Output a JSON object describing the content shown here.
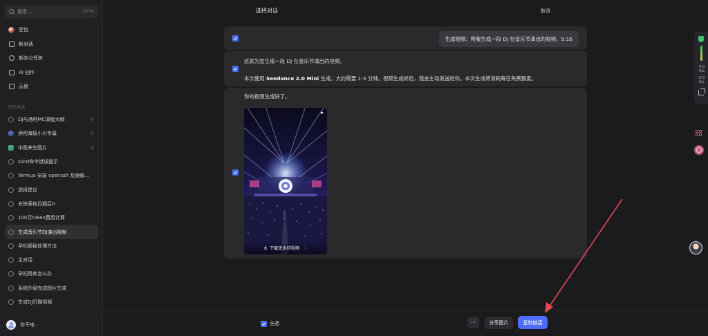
{
  "sidebar": {
    "search_placeholder": "搜索...",
    "search_shortcut": "Ctrl K",
    "nav": [
      {
        "label": "豆包",
        "icon": "doubao-logo-icon"
      },
      {
        "label": "新对话",
        "icon": "new-chat-icon"
      },
      {
        "label": "新办公任务",
        "icon": "task-icon"
      },
      {
        "label": "AI 创作",
        "icon": "image-create-icon"
      },
      {
        "label": "云盘",
        "icon": "folder-icon"
      }
    ],
    "history_label": "历史对话",
    "history": [
      {
        "label": "DJ与酒吧MC课程大纲",
        "pinned": true
      },
      {
        "label": "酒吧海报小川专属",
        "pinned": true
      },
      {
        "label": "中医养生图片",
        "pinned": true
      },
      {
        "label": "sshd命令错误提示"
      },
      {
        "label": "Termux 安装 openssh 及镜像..."
      },
      {
        "label": "选择建议"
      },
      {
        "label": "去除表格日期后0"
      },
      {
        "label": "100万token费用计算"
      },
      {
        "label": "生成音乐节DJ演出视频",
        "active": true
      },
      {
        "label": "孕妇便秘处理方法"
      },
      {
        "label": "主对话"
      },
      {
        "label": "孕妇胃疼怎么办"
      },
      {
        "label": "系统升级完成图片生成"
      },
      {
        "label": "生成DJ打碟视频"
      }
    ],
    "user_name": "你干啥",
    "pin_glyph": "⚲"
  },
  "header": {
    "title": "选择对话",
    "cancel": "取消"
  },
  "messages": {
    "user_msg": "生成视频：帮我生成一段 DJ 在音乐节演出的视频，9:16",
    "reply1_line1": "这就为您生成一段 DJ 在音乐节演出的视频。",
    "reply1_line2_pre": "本次使用 ",
    "reply1_line2_bold": "Seedance 2.0 Mini",
    "reply1_line2_post": " 生成，大约需要 1-3 分钟。视频生成好后，我会主动发送给你。本次生成将消耗每日免费额度。",
    "reply2_text": "你的视频生成好了。",
    "video_download": "下载无水印视频"
  },
  "rail": {
    "stat1_value": "0.0",
    "stat1_unit": "K/s",
    "stat2_value": "0.0",
    "stat2_unit": "K/s"
  },
  "bottom": {
    "select_all": "全选",
    "more": "···",
    "share_image": "分享图片",
    "copy_link": "复制链接"
  },
  "colors": {
    "accent": "#4d6ef8",
    "checkbox": "#4a6cf7",
    "annotation_arrow": "#e5484d"
  }
}
